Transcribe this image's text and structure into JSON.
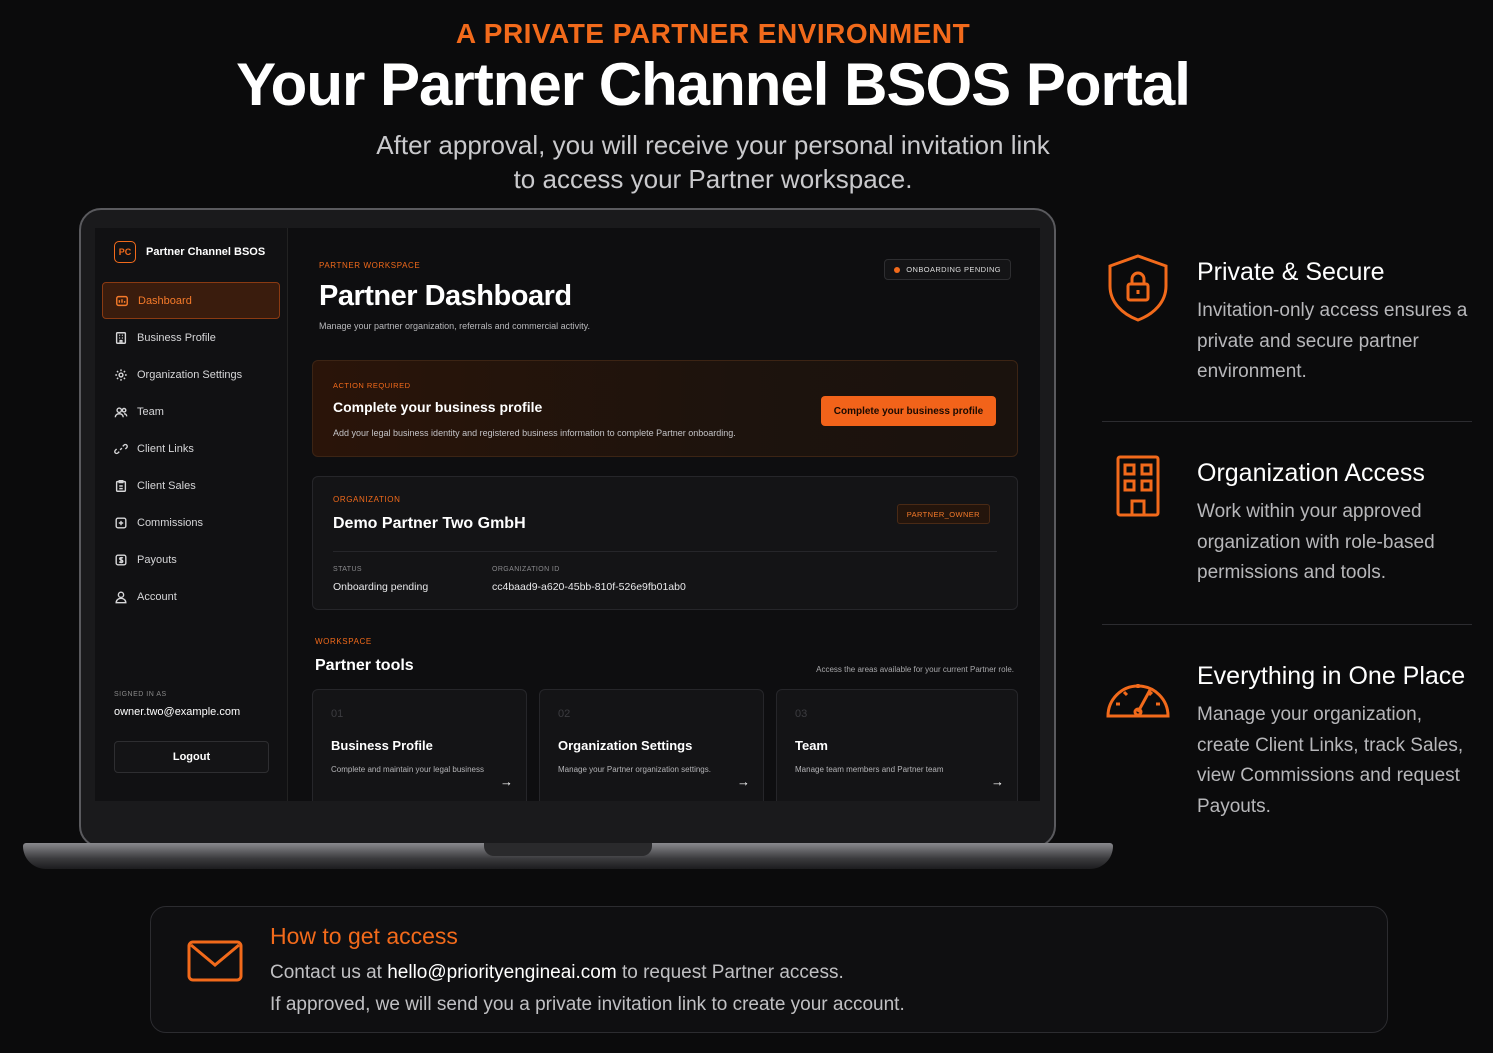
{
  "hero": {
    "eyebrow": "A PRIVATE PARTNER ENVIRONMENT",
    "title": "Your Partner Channel BSOS Portal",
    "subtitle_line1": "After approval, you will receive your personal invitation link",
    "subtitle_line2": "to access your Partner workspace."
  },
  "app": {
    "brand_logo": "PC",
    "brand_name": "Partner Channel BSOS",
    "nav": [
      {
        "label": "Dashboard",
        "icon": "dashboard-icon"
      },
      {
        "label": "Business Profile",
        "icon": "building-icon"
      },
      {
        "label": "Organization Settings",
        "icon": "gear-icon"
      },
      {
        "label": "Team",
        "icon": "users-icon"
      },
      {
        "label": "Client Links",
        "icon": "link-icon"
      },
      {
        "label": "Client Sales",
        "icon": "clipboard-icon"
      },
      {
        "label": "Commissions",
        "icon": "plus-square-icon"
      },
      {
        "label": "Payouts",
        "icon": "dollar-icon"
      },
      {
        "label": "Account",
        "icon": "user-icon"
      }
    ],
    "signed_in_label": "SIGNED IN AS",
    "signed_in_email": "owner.two@example.com",
    "logout_label": "Logout",
    "workspace_label": "PARTNER WORKSPACE",
    "page_title": "Partner Dashboard",
    "page_desc": "Manage your partner organization, referrals and commercial activity.",
    "status_pill": "ONBOARDING PENDING",
    "action": {
      "label": "ACTION REQUIRED",
      "title": "Complete your business profile",
      "desc": "Add your legal business identity and registered business information to complete Partner onboarding.",
      "button": "Complete your business profile"
    },
    "org": {
      "label": "ORGANIZATION",
      "name": "Demo Partner Two GmbH",
      "role_badge": "PARTNER_OWNER",
      "status_key": "STATUS",
      "status_value": "Onboarding pending",
      "id_key": "ORGANIZATION ID",
      "id_value": "cc4baad9-a620-45bb-810f-526e9fb01ab0"
    },
    "tools": {
      "label": "WORKSPACE",
      "title": "Partner tools",
      "desc": "Access the areas available for your current Partner role.",
      "cards": [
        {
          "num": "01",
          "title": "Business Profile",
          "desc": "Complete and maintain your legal business",
          "arrow": "→"
        },
        {
          "num": "02",
          "title": "Organization Settings",
          "desc": "Manage your Partner organization settings.",
          "arrow": "→"
        },
        {
          "num": "03",
          "title": "Team",
          "desc": "Manage team members and Partner team",
          "arrow": "→"
        }
      ]
    }
  },
  "features": [
    {
      "icon": "shield-lock-icon",
      "title": "Private & Secure",
      "desc": "Invitation-only access ensures a private and secure partner environment."
    },
    {
      "icon": "building-icon",
      "title": "Organization Access",
      "desc": "Work within your approved organization with role-based permissions and tools."
    },
    {
      "icon": "gauge-icon",
      "title": "Everything in One Place",
      "desc": "Manage your organization, create Client Links, track Sales, view Commissions and request Payouts."
    }
  ],
  "access": {
    "icon": "mail-icon",
    "title": "How to get access",
    "line1_prefix": "Contact us at ",
    "email": "hello@priorityengineai.com",
    "line1_suffix": " to request Partner access.",
    "line2": "If approved, we will send you a private invitation link to create your account."
  },
  "colors": {
    "accent": "#f26a1b",
    "background": "#0b0b0c"
  }
}
